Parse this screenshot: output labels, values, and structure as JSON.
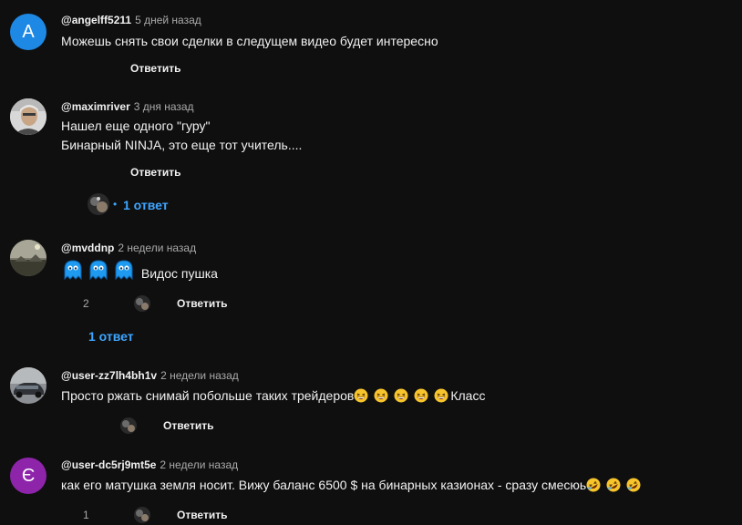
{
  "colors": {
    "background": "#0f0f0f",
    "text": "#f1f1f1",
    "secondary_text": "#aaaaaa",
    "link": "#3ea6ff",
    "avatar_blue": "#1e88e5",
    "avatar_purple": "#8e24aa"
  },
  "reply_label": "Ответить",
  "comments": [
    {
      "author": "@angelff5211",
      "time": "5 дней назад",
      "avatar_letter": "A",
      "lines": [
        "Можешь снять свои сделки в следущем видео будет интересно"
      ]
    },
    {
      "author": "@maximriver",
      "time": "3 дня назад",
      "lines": [
        "Нашел еще одного \"гуру\"",
        "Бинарный NINJA, это еще тот учитель...."
      ],
      "replies_label": "1 ответ",
      "replies_dot": "•"
    },
    {
      "author": "@mvddnp",
      "time": "2 недели назад",
      "text": "Видос пушка",
      "emoji": "ghost-emoji",
      "likes": "2",
      "replies_label": "1 ответ"
    },
    {
      "author": "@user-zz7lh4bh1v",
      "time": "2 недели назад",
      "text": "Просто ржать снимай побольше таких трейдеров",
      "text_after": "Класс",
      "emoji": "grinning-squinting-face-emoji"
    },
    {
      "author": "@user-dc5rj9mt5e",
      "time": "2 недели назад",
      "avatar_letter": "Є",
      "text": "как его матушка земля носит. Вижу баланс 6500 $ на бинарных казионах - сразу смесюь",
      "emoji": "rolling-on-floor-laughing-emoji",
      "likes": "1"
    }
  ]
}
